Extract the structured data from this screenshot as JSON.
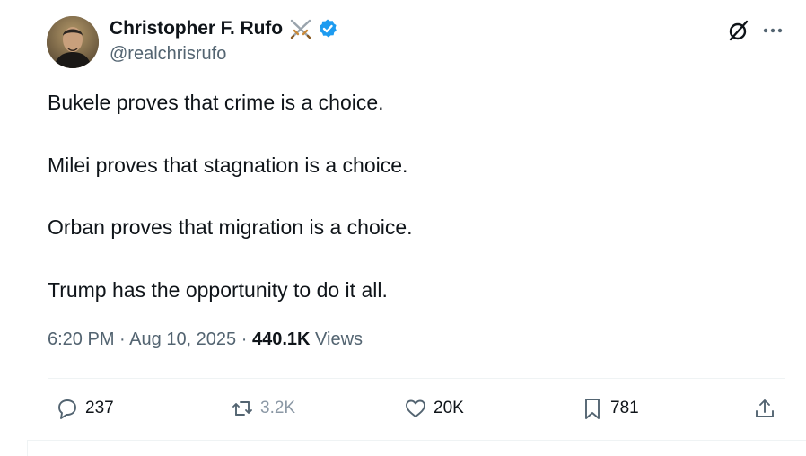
{
  "author": {
    "display_name": "Christopher F. Rufo",
    "name_emoji": "crossed-swords-icon",
    "handle": "@realchrisrufo",
    "verified_color": "#1d9bf0"
  },
  "tweet": {
    "lines": [
      "Bukele proves that crime is a choice.",
      "Milei proves that stagnation is a choice.",
      "Orban proves that migration is a choice.",
      "Trump has the opportunity to do it all."
    ],
    "time": "6:20 PM",
    "separator": "·",
    "date": "Aug 10, 2025",
    "views_count": "440.1K",
    "views_label": "Views"
  },
  "actions": {
    "replies": "237",
    "reposts": "3.2K",
    "likes": "20K",
    "bookmarks": "781"
  },
  "colors": {
    "text": "#0f1419",
    "secondary": "#536471",
    "muted": "#8b98a5",
    "divider": "#eff3f4",
    "accent": "#1d9bf0"
  }
}
